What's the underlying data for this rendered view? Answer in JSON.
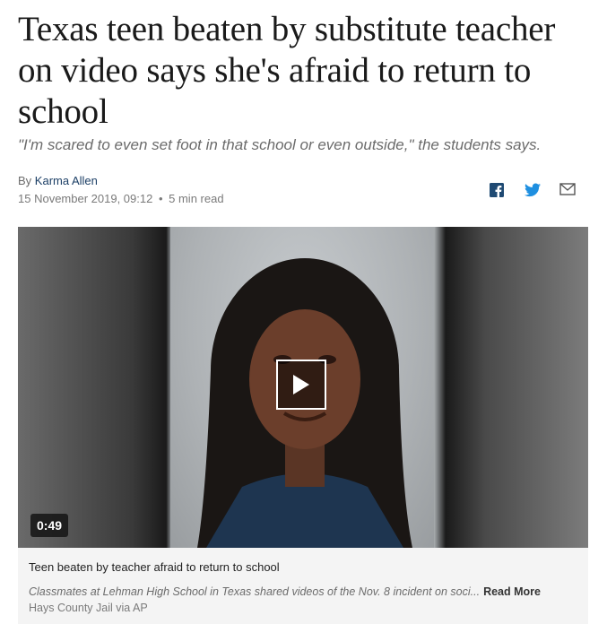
{
  "article": {
    "headline": "Texas teen beaten by substitute teacher on video says she's afraid to return to school",
    "dek": "\"I'm scared to even set foot in that school or even outside,\" the students says.",
    "byline_prefix": "By",
    "author": "Karma Allen",
    "date": "15 November 2019, 09:12",
    "read_time": "5 min read"
  },
  "share": {
    "icons": [
      "facebook-icon",
      "twitter-icon",
      "email-icon"
    ]
  },
  "video": {
    "duration": "0:49",
    "title": "Teen beaten by teacher afraid to return to school",
    "description": "Classmates at Lehman High School in Texas shared videos of the Nov. 8 incident on soci...",
    "read_more": "Read More",
    "credit": "Hays County Jail via AP"
  },
  "colors": {
    "author_link": "#1c3f66",
    "share_icon": "#1f4a73",
    "caption_bg": "#f4f4f4"
  }
}
